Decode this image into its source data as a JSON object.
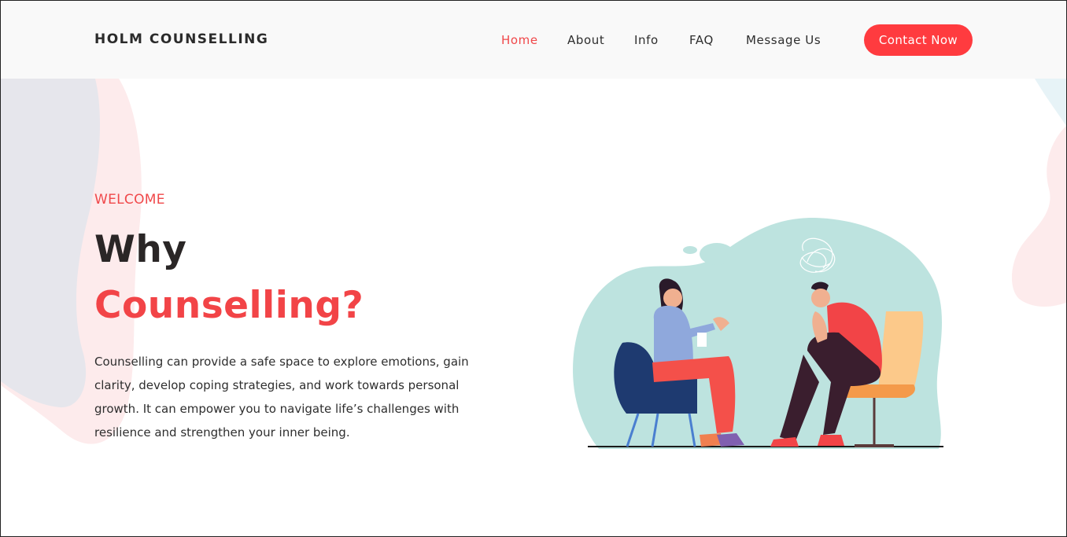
{
  "header": {
    "logo": "HOLM COUNSELLING",
    "nav": [
      {
        "label": "Home",
        "active": true
      },
      {
        "label": "About",
        "active": false
      },
      {
        "label": "Info",
        "active": false
      },
      {
        "label": "FAQ",
        "active": false
      },
      {
        "label": "Message Us",
        "active": false
      }
    ],
    "cta_label": "Contact Now"
  },
  "hero": {
    "eyebrow": "WELCOME",
    "title_line1": "Why",
    "title_line2": "Counselling?",
    "body": "Counselling can provide a safe space to explore emotions, gain clarity, develop coping strategies, and work towards personal growth. It can empower you to navigate life’s challenges with resilience and strengthen your inner being."
  },
  "illustration": {
    "subject": "counselling-session-illustration"
  },
  "colors": {
    "accent": "#ff3b3f",
    "accent_text": "#f0484a",
    "dark_text": "#2a2626",
    "header_bg": "#f9f9f9",
    "blob_teal": "#bde3df"
  }
}
